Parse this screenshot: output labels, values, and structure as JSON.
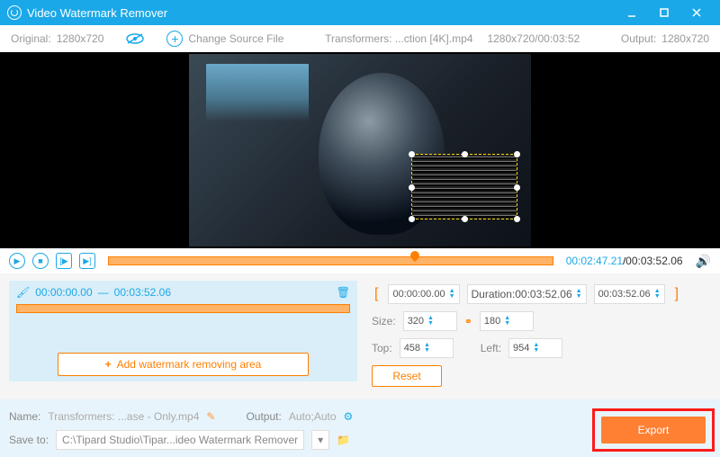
{
  "titlebar": {
    "title": "Video Watermark Remover"
  },
  "toolbar": {
    "original_label": "Original:",
    "original_res": "1280x720",
    "change_source": "Change Source File",
    "file_name": "Transformers: ...ction [4K].mp4",
    "file_info": "1280x720/00:03:52",
    "output_label": "Output:",
    "output_res": "1280x720"
  },
  "timeline": {
    "current": "00:02:47.21",
    "total": "00:03:52.06"
  },
  "left_panel": {
    "range_start": "00:00:00.00",
    "range_sep": "—",
    "range_end": "00:03:52.06",
    "add_area": "Add watermark removing area"
  },
  "right_panel": {
    "start": "00:00:00.00",
    "duration_label": "Duration:",
    "duration_val": "00:03:52.06",
    "end": "00:03:52.06",
    "size_label": "Size:",
    "size_w": "320",
    "size_h": "180",
    "top_label": "Top:",
    "top_val": "458",
    "left_label": "Left:",
    "left_val": "954",
    "reset": "Reset"
  },
  "bottom": {
    "name_label": "Name:",
    "name_val": "Transformers: ...ase - Only.mp4",
    "output_label": "Output:",
    "output_val": "Auto;Auto",
    "save_label": "Save to:",
    "save_path": "C:\\Tipard Studio\\Tipar...ideo Watermark Remover",
    "export": "Export"
  },
  "selection": {
    "left_pct": 65,
    "top_pct": 52,
    "w_pct": 31,
    "h_pct": 34
  }
}
